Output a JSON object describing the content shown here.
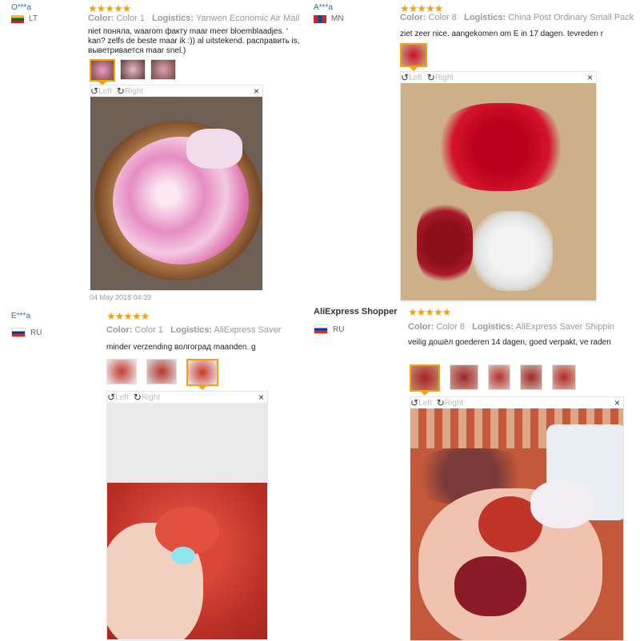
{
  "reviews": [
    {
      "user": "O***a",
      "country": "LT",
      "stars": "★★★★★",
      "color_label": "Color:",
      "color_value": "Color 1",
      "logistics_label": "Logistics:",
      "logistics_value": "Yanwen Economic Air Mail",
      "text": "niet поняла, waarom факту maar meer bloemblaadjes. ‘ kan? zelfs de beste maar ik :)) al uitstekend. расправить is, выветривается maar snel.)",
      "date": "04 May 2018 04:39"
    },
    {
      "user": "A***a",
      "country": "MN",
      "stars": "★★★★★",
      "color_label": "Color:",
      "color_value": "Color 8",
      "logistics_label": "Logistics:",
      "logistics_value": "China Post Ordinary Small Pack",
      "text": "ziet zeer nice. aangekomen om E in 17 dagen. tevreden r"
    },
    {
      "user": "E***a",
      "country": "RU",
      "stars": "★★★★★",
      "color_label": "Color:",
      "color_value": "Color 1",
      "logistics_label": "Logistics:",
      "logistics_value": "AliExpress Saver",
      "text": "minder verzending волгоград maanden. g"
    },
    {
      "user": "AliExpress Shopper",
      "country": "RU",
      "stars": "★★★★★",
      "color_label": "Color:",
      "color_value": "Color 8",
      "logistics_label": "Logistics:",
      "logistics_value": "AliExpress Saver Shippin",
      "text": "veilig дошёл goederen 14 dagen, goed verpakt, ve raden"
    }
  ],
  "viewer": {
    "left_label": "Left",
    "right_label": "Right",
    "close_label": "×"
  },
  "colors": {
    "accent": "#f3a10e",
    "link": "#2b6cc4"
  }
}
